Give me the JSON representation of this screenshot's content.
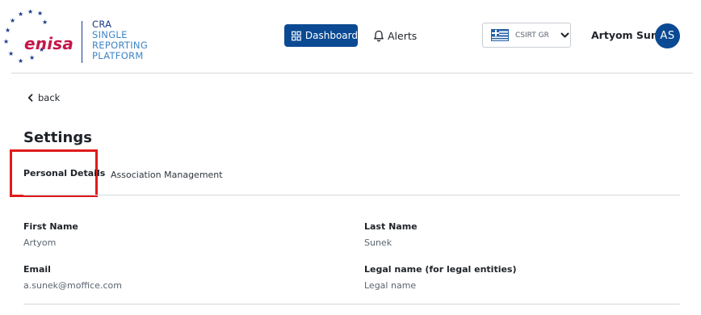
{
  "logo": {
    "wordmark": "enisa"
  },
  "platform": {
    "line1": "CRA",
    "line2": "SINGLE",
    "line3": "REPORTING",
    "line4": "PLATFORM"
  },
  "nav": {
    "dashboard_label": "Dashboard",
    "dashboard_icon": "dashboard-grid-icon",
    "alerts_label": "Alerts",
    "alerts_icon": "bell-icon"
  },
  "csirt_selector": {
    "selected": "CSIRT GR",
    "flag": "greece-flag-icon",
    "chevron": "chevron-down-icon"
  },
  "user": {
    "name": "Artyom Sunek",
    "initials": "AS"
  },
  "back_label": "back",
  "page_title": "Settings",
  "tabs": [
    {
      "label": "Personal Details",
      "active": true
    },
    {
      "label": "Association Management",
      "active": false
    }
  ],
  "fields": {
    "first_name": {
      "label": "First Name",
      "value": "Artyom"
    },
    "last_name": {
      "label": "Last Name",
      "value": "Sunek"
    },
    "email": {
      "label": "Email",
      "value": "a.sunek@moffice.com"
    },
    "legal_name": {
      "label": "Legal name (for legal entities)",
      "value": "Legal name"
    }
  },
  "colors": {
    "primary": "#0b4a93",
    "brand_red": "#c5164a",
    "highlight": "#e01b1b"
  }
}
